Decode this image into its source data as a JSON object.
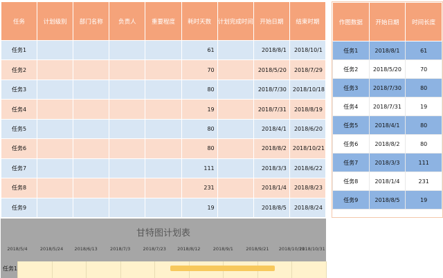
{
  "main_table": {
    "headers": [
      "任务",
      "计划级别",
      "部门名称",
      "负责人",
      "重要程度",
      "耗时天数",
      "计划完成时间",
      "开始日期",
      "结束时期"
    ],
    "rows": [
      {
        "task": "任务1",
        "days": "61",
        "start": "2018/8/1",
        "end": "2018/10/1"
      },
      {
        "task": "任务2",
        "days": "70",
        "start": "2018/5/20",
        "end": "2018/7/29"
      },
      {
        "task": "任务3",
        "days": "80",
        "start": "2018/7/30",
        "end": "2018/10/18"
      },
      {
        "task": "任务4",
        "days": "19",
        "start": "2018/7/31",
        "end": "2018/8/19"
      },
      {
        "task": "任务5",
        "days": "80",
        "start": "2018/4/1",
        "end": "2018/6/20"
      },
      {
        "task": "任务6",
        "days": "80",
        "start": "2018/8/2",
        "end": "2018/10/21"
      },
      {
        "task": "任务7",
        "days": "111",
        "start": "2018/3/3",
        "end": "2018/6/22"
      },
      {
        "task": "任务8",
        "days": "231",
        "start": "2018/1/4",
        "end": "2018/8/23"
      },
      {
        "task": "任务9",
        "days": "19",
        "start": "2018/8/5",
        "end": "2018/8/24"
      }
    ]
  },
  "side_table": {
    "headers": [
      "作图数据",
      "开始日期",
      "时间长度"
    ],
    "rows": [
      {
        "task": "任务1",
        "start": "2018/8/1",
        "length": "61"
      },
      {
        "task": "任务2",
        "start": "2018/5/20",
        "length": "70"
      },
      {
        "task": "任务3",
        "start": "2018/7/30",
        "length": "80"
      },
      {
        "task": "任务4",
        "start": "2018/7/31",
        "length": "19"
      },
      {
        "task": "任务5",
        "start": "2018/4/1",
        "length": "80"
      },
      {
        "task": "任务6",
        "start": "2018/8/2",
        "length": "80"
      },
      {
        "task": "任务7",
        "start": "2018/3/3",
        "length": "111"
      },
      {
        "task": "任务8",
        "start": "2018/1/4",
        "length": "231"
      },
      {
        "task": "任务9",
        "start": "2018/8/5",
        "length": "19"
      }
    ]
  },
  "chart_data": {
    "type": "bar",
    "title": "甘特图计划表",
    "x_ticks": [
      "2018/5/4",
      "2018/5/24",
      "2018/6/13",
      "2018/7/3",
      "2018/7/23",
      "2018/8/12",
      "2018/9/1",
      "2018/9/21",
      "2018/10/11",
      "2018/10/31"
    ],
    "xlim": [
      "2018/5/4",
      "2018/10/31"
    ],
    "categories": [
      "任务1"
    ],
    "series": [
      {
        "start": [
          "2018/8/1"
        ],
        "end": [
          "2018/10/1"
        ]
      }
    ],
    "colors": {
      "bar": "#f7c85c",
      "plot_bg": "#fff2cc",
      "panel_bg": "#a6a6a6"
    }
  }
}
